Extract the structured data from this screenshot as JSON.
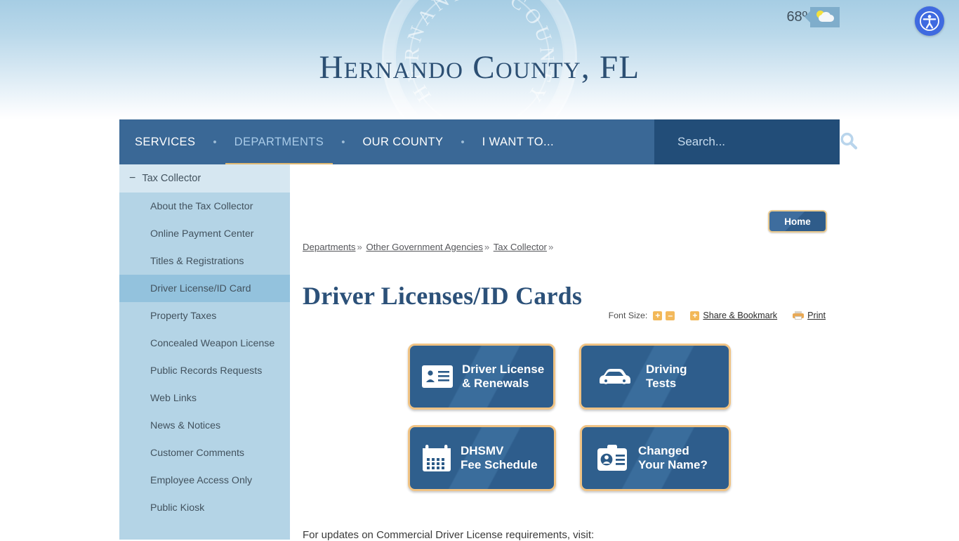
{
  "header": {
    "site_title": "Hernando County, FL",
    "weather": {
      "temperature": "68º",
      "icon": "partly-cloudy-icon"
    },
    "accessibility_icon": "accessibility-icon",
    "seal_watermark_text": "HERNANDO COUNTY"
  },
  "nav": {
    "items": [
      {
        "label": "SERVICES",
        "active": false
      },
      {
        "label": "DEPARTMENTS",
        "active": true
      },
      {
        "label": "OUR COUNTY",
        "active": false
      },
      {
        "label": "I WANT TO...",
        "active": false
      }
    ],
    "separator": "•",
    "search": {
      "placeholder": "Search...",
      "value": "",
      "icon": "search-icon"
    },
    "accent_color": "#e0b972",
    "bar_color": "#3a6896",
    "search_bg_color": "#224d78"
  },
  "sidebar": {
    "header": {
      "label": "Tax Collector",
      "toggle_icon": "minus-icon"
    },
    "items": [
      {
        "label": "About the Tax Collector",
        "active": false
      },
      {
        "label": "Online Payment Center",
        "active": false
      },
      {
        "label": "Titles & Registrations",
        "active": false
      },
      {
        "label": "Driver License/ID Card",
        "active": true
      },
      {
        "label": "Property Taxes",
        "active": false
      },
      {
        "label": "Concealed Weapon License",
        "active": false
      },
      {
        "label": "Public Records Requests",
        "active": false
      },
      {
        "label": "Web Links",
        "active": false
      },
      {
        "label": "News & Notices",
        "active": false
      },
      {
        "label": "Customer Comments",
        "active": false
      },
      {
        "label": "Employee Access Only",
        "active": false
      },
      {
        "label": "Public Kiosk",
        "active": false
      }
    ],
    "bg_color": "#b4d4e6",
    "active_color": "#93c2dd"
  },
  "content": {
    "home_button": "Home",
    "breadcrumb": [
      "Departments",
      "Other Government Agencies",
      "Tax Collector"
    ],
    "breadcrumb_separator": "»",
    "page_title": "Driver Licenses/ID Cards",
    "tools": {
      "font_size_label": "Font Size:",
      "increase": "+",
      "decrease": "–",
      "share_plus": "+",
      "share_label": "Share & Bookmark",
      "print_label": "Print",
      "print_icon": "printer-icon"
    },
    "tiles": [
      {
        "label": "Driver License\n& Renewals",
        "icon": "id-card-icon"
      },
      {
        "label": "Driving\nTests",
        "icon": "car-icon"
      },
      {
        "label": "DHSMV\nFee Schedule",
        "icon": "calendar-icon"
      },
      {
        "label": "Changed\nYour Name?",
        "icon": "id-badge-icon"
      }
    ],
    "body_text": "For updates on Commercial Driver License requirements, visit:",
    "tile_border_color": "#f0c384",
    "tile_bg_color": "#2f5f8d"
  }
}
